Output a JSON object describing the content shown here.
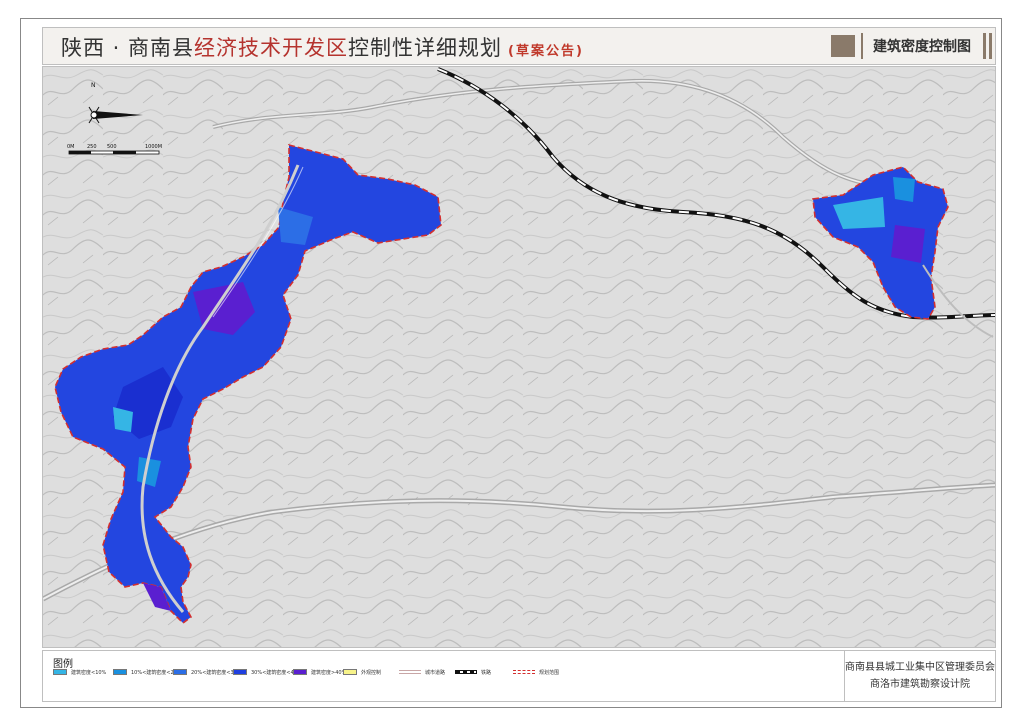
{
  "header": {
    "title_part1": "陕西 · 商南县",
    "title_red": "经济技术开发区",
    "title_part2": "控制性详细规划",
    "title_note": "(草案公告)",
    "map_name": "建筑密度控制图"
  },
  "map": {
    "north_label": "N",
    "scale_labels": [
      "0M",
      "250",
      "500",
      "1000M"
    ]
  },
  "legend": {
    "title": "图例",
    "items": [
      {
        "label": "建筑密度<10%",
        "color": "#35b5e5",
        "kind": "swatch"
      },
      {
        "label": "10%<建筑密度<20%",
        "color": "#1a90df",
        "kind": "swatch"
      },
      {
        "label": "20%<建筑密度<30%",
        "color": "#2c6ee6",
        "kind": "swatch"
      },
      {
        "label": "30%<建筑密度<40%",
        "color": "#1f3fe0",
        "kind": "swatch"
      },
      {
        "label": "建筑密度>40%",
        "color": "#5a1fd0",
        "kind": "swatch"
      },
      {
        "label": "外观控制",
        "color": "#f7f38a",
        "kind": "swatch"
      },
      {
        "label": "城市道路",
        "color": "#c8a6a6",
        "kind": "road"
      },
      {
        "label": "铁路",
        "color": "#111111",
        "kind": "rail"
      },
      {
        "label": "规划范围",
        "color": "#d32f2f",
        "kind": "boundary"
      }
    ]
  },
  "organization": {
    "line1": "商南县县城工业集中区管理委员会",
    "line2": "商洛市建筑勘察设计院"
  },
  "colors": {
    "boundary": "#d32f2f",
    "road": "#c9c9c9",
    "railway": "#111111",
    "terrain": "#dcdcdc"
  }
}
